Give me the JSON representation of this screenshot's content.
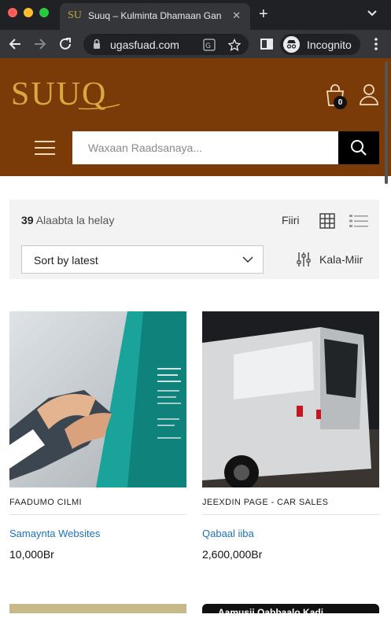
{
  "browser": {
    "tab_favicon": "SU",
    "tab_title": "Suuq – Kulminta Dhamaan Gan",
    "tab_close": "✕",
    "new_tab": "+",
    "url": "ugasfuad.com",
    "incognito_label": "Incognito"
  },
  "header": {
    "logo_text": "SUUQ",
    "cart_count": "0",
    "search_placeholder": "Waxaan Raadsanaya...",
    "brand_bg": "#7a3b09",
    "logo_color": "#d9a93f"
  },
  "toolbar": {
    "result_count": "39",
    "result_label": "Alaabta la helay",
    "filter_label": "Fiiri",
    "sort_value": "Sort by latest",
    "filters_label": "Kala-Miir"
  },
  "products": [
    {
      "vendor": "FAADUMO CILMI",
      "name": "Samaynta Websites",
      "price": "10,000Br"
    },
    {
      "vendor": "JEEXDIN PAGE - CAR SALES",
      "name": "Qabaal iiba",
      "price": "2,600,000Br"
    }
  ],
  "peek": {
    "second_text": "Aamusii Qabbaalo Kadi"
  }
}
